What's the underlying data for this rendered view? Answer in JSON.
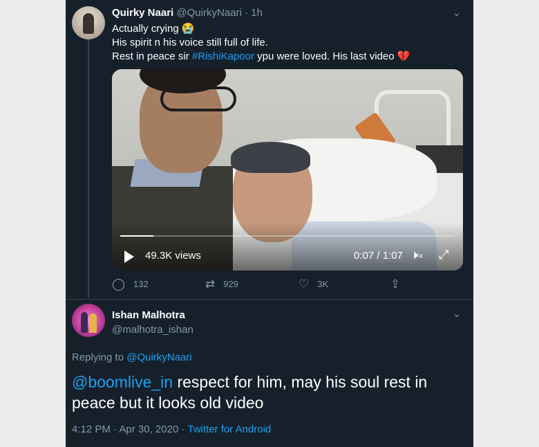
{
  "tweet1": {
    "name": "Quirky Naari",
    "handle": "@QuirkyNaari",
    "separator": "·",
    "time": "1h",
    "line1": "Actually crying",
    "line1_emoji": "😭",
    "line2": "His spirit n his voice still full of life.",
    "line3_pre": "Rest in peace sir ",
    "line3_hashtag": "#RishiKapoor",
    "line3_post": " ypu were loved. His last video",
    "line3_emoji": "💔",
    "video": {
      "views": "49.3K views",
      "time": "0:07 / 1:07",
      "progress": 0.1
    },
    "actions": {
      "replies": "132",
      "retweets": "929",
      "likes": "3K"
    }
  },
  "tweet2": {
    "name": "Ishan Malhotra",
    "handle": "@malhotra_ishan",
    "replying_prefix": "Replying to ",
    "replying_to": "@QuirkyNaari",
    "mention": "@boomlive_in",
    "text": " respect for him, may his soul rest in peace but it looks old video",
    "time": "4:12 PM",
    "dot": "·",
    "date": "Apr 30, 2020",
    "source": "Twitter for Android"
  },
  "icons": {
    "chevron": "chevron-down-icon",
    "reply": "reply-icon",
    "retweet": "retweet-icon",
    "like": "heart-icon",
    "share": "share-icon",
    "play": "play-icon",
    "mute": "mute-icon",
    "fullscreen": "fullscreen-icon"
  },
  "colors": {
    "background": "#15202b",
    "link": "#1da1f2",
    "muted": "#8899a6",
    "page": "#ebebeb"
  }
}
